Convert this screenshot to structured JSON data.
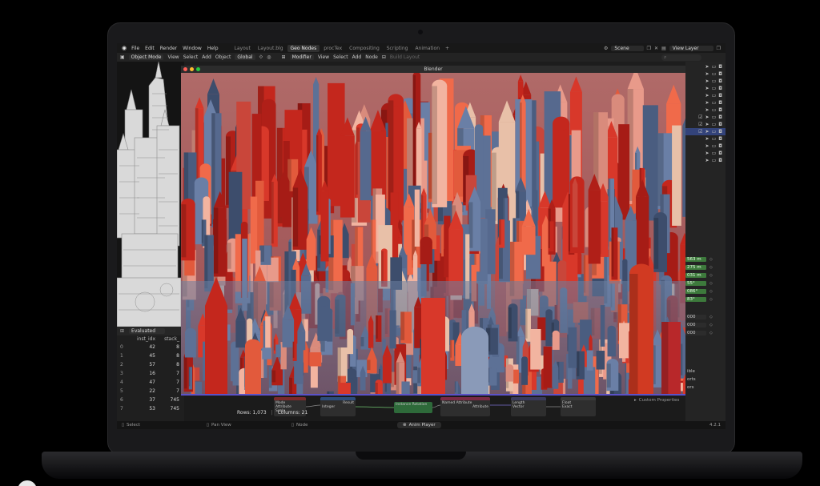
{
  "topbar": {
    "menus": [
      "File",
      "Edit",
      "Render",
      "Window",
      "Help"
    ],
    "workspaces": [
      "Layout",
      "Layout.blg",
      "Geo Nodes",
      "procTex",
      "Compositing",
      "Scripting",
      "Animation"
    ],
    "active_workspace": "Geo Nodes",
    "scene_label": "Scene",
    "view_layer_label": "View Layer"
  },
  "toolbar": {
    "mode": "Object Mode",
    "left_items": [
      "View",
      "Select",
      "Add",
      "Object"
    ],
    "transform": "Global",
    "editor": "Modifier",
    "right_items": [
      "View",
      "Select",
      "Add",
      "Node"
    ],
    "build_layout": "Build Layout"
  },
  "player": {
    "title": "Blender",
    "accent_color": "#5b52c8"
  },
  "spreadsheet": {
    "mode": "Evaluated",
    "columns": [
      "inst_idx",
      "stack_"
    ],
    "rows": [
      {
        "index": "0",
        "inst_idx": "42",
        "stack": "8"
      },
      {
        "index": "1",
        "inst_idx": "45",
        "stack": "8"
      },
      {
        "index": "2",
        "inst_idx": "57",
        "stack": "8"
      },
      {
        "index": "3",
        "inst_idx": "16",
        "stack": "7"
      },
      {
        "index": "4",
        "inst_idx": "47",
        "stack": "7"
      },
      {
        "index": "5",
        "inst_idx": "22",
        "stack": "7"
      },
      {
        "index": "6",
        "inst_idx": "37",
        "stack": "745"
      },
      {
        "index": "7",
        "inst_idx": "53",
        "stack": "745"
      }
    ],
    "rows_label": "Rows: 1,073",
    "columns_label": "Columns: 21"
  },
  "properties": {
    "values": [
      "563 m",
      "275 m",
      "031 m",
      "55°",
      "086°",
      "83°"
    ],
    "grey_values": [
      "000",
      "000",
      "000"
    ],
    "labels": [
      "ible",
      "orts",
      "ors"
    ],
    "custom_properties": "Custom Properties"
  },
  "nodes": {
    "labels": [
      "Mode",
      "Attribute",
      "Scale",
      "Result",
      "Integer",
      "Instance Rotation",
      "Named Attribute",
      "Attribute",
      "Length",
      "Vector",
      "Float",
      "Exact"
    ]
  },
  "statusbar": {
    "select": "Select",
    "pan_view": "Pan View",
    "node": "Node",
    "anim_player": "Anim Player",
    "version": "4.2.1"
  },
  "colors": {
    "ui_bg": "#1d1d1d",
    "active_selection": "#33437a",
    "property_green": "#3d7a3c",
    "render_sky": "#a55a5e",
    "render_red": "#c4271d",
    "render_blue": "#4a5d80"
  }
}
